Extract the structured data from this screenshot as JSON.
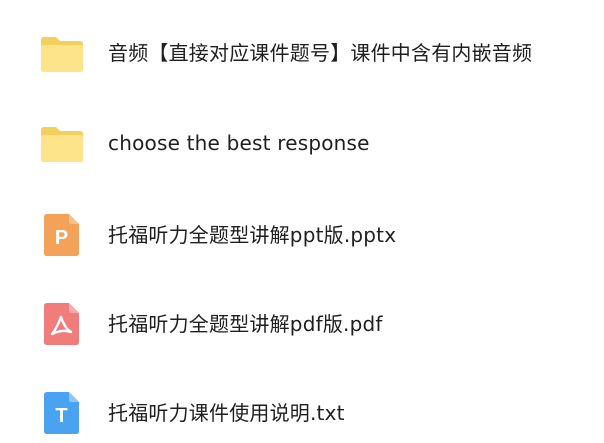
{
  "files": [
    {
      "name": "音频【直接对应课件题号】课件中含有内嵌音频",
      "icon": "folder-icon",
      "type": "folder"
    },
    {
      "name": "choose the best response",
      "icon": "folder-icon",
      "type": "folder"
    },
    {
      "name": "托福听力全题型讲解ppt版.pptx",
      "icon": "pptx-file-icon",
      "type": "pptx",
      "glyph": "P"
    },
    {
      "name": "托福听力全题型讲解pdf版.pdf",
      "icon": "pdf-file-icon",
      "type": "pdf"
    },
    {
      "name": "托福听力课件使用说明.txt",
      "icon": "txt-file-icon",
      "type": "txt",
      "glyph": "T"
    }
  ],
  "colors": {
    "folder_back": "#f5cf5c",
    "folder_front": "#fde48a",
    "pptx": "#f4a259",
    "pdf": "#f17c7c",
    "txt": "#4aa3f0",
    "text": "#1f1f1f"
  }
}
